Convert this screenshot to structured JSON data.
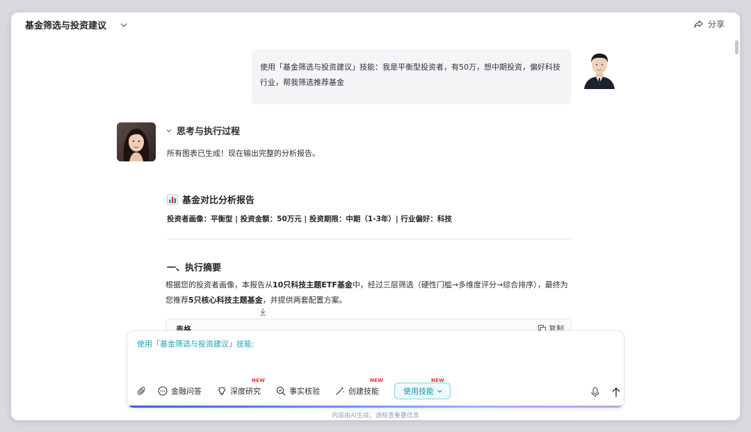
{
  "header": {
    "title": "基金筛选与投资建议",
    "share_label": "分享"
  },
  "conversation": {
    "user_message": "使用「基金筛选与投资建议」技能：我是平衡型投资者，有50万，想中期投资，偏好科技行业，帮我筛选推荐基金",
    "thinking_label": "思考与执行过程",
    "status_text": "所有图表已生成！现在输出完整的分析报告。",
    "report": {
      "title": "基金对比分析报告",
      "investor_profile": "投资者画像：平衡型 | 投资金额：50万元 | 投资期限：中期（1-3年）| 行业偏好：科技",
      "section_title": "一、执行摘要",
      "summary_part1": "根据您的投资者画像，本报告从",
      "summary_bold1": "10只科技主题ETF基金",
      "summary_part2": "中，经过三层筛选（硬性门槛→多维度评分→综合排序），最终为您推荐",
      "summary_bold2": "5只核心科技主题基金",
      "summary_part3": "，并提供两套配置方案。",
      "code_card": {
        "language": "表格",
        "copy_label": "复制"
      }
    }
  },
  "composer": {
    "input_text": "使用「基金筛选与投资建议」技能:",
    "tools": [
      {
        "label": "金融问答",
        "icon": "chat-bubble-icon",
        "new": false
      },
      {
        "label": "深度研究",
        "icon": "lightbulb-icon",
        "new": true
      },
      {
        "label": "事实核验",
        "icon": "magnifier-check-icon",
        "new": false
      },
      {
        "label": "创建技能",
        "icon": "magic-wand-icon",
        "new": true
      }
    ],
    "skill_button_label": "使用技能",
    "new_badge": "NEW"
  },
  "footer_note": "内容由AI生成，请核查重要信息",
  "colors": {
    "accent": "#1597a8",
    "badge": "#e03131",
    "gradient_start": "#3b5bdb"
  }
}
